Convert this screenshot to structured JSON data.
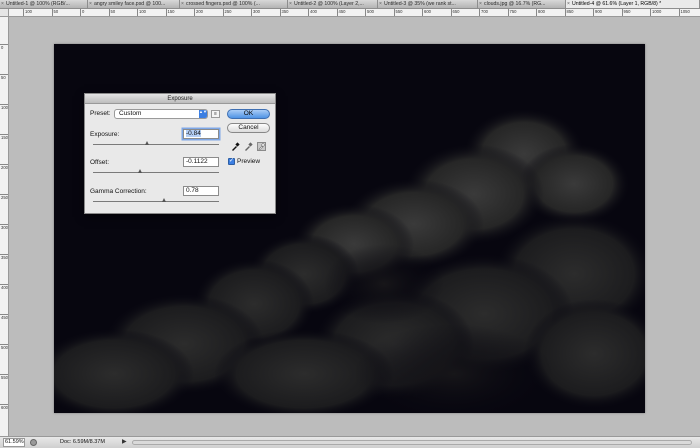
{
  "tabs": [
    {
      "label": "Untitled-1 @ 100% (RGB/..."
    },
    {
      "label": "angry smiley face.psd @ 100..."
    },
    {
      "label": "crossed fingers.psd @ 100% (..."
    },
    {
      "label": "Untitled-2 @ 100% (Layer 2,..."
    },
    {
      "label": "Untitled-3 @ 35% (we rank st..."
    },
    {
      "label": "clouds.jpg @ 16.7% (RG..."
    },
    {
      "label": "Untitled-4 @ 61.6% (Layer 1, RGB/8) *"
    }
  ],
  "rulers": {
    "horizontal": [
      "100",
      "50",
      "0",
      "50",
      "100",
      "150",
      "200",
      "250",
      "300",
      "350",
      "400",
      "450",
      "500",
      "550",
      "600",
      "650",
      "700",
      "750",
      "800",
      "850",
      "900",
      "950",
      "1000",
      "1050"
    ],
    "vertical": [
      "0",
      "50",
      "100",
      "150",
      "200",
      "250",
      "300",
      "350",
      "400",
      "450",
      "500",
      "550",
      "600"
    ]
  },
  "status": {
    "zoom": "61.59%",
    "doc": "Doc: 6.59M/8.37M",
    "arrow": "▶"
  },
  "dialog": {
    "title": "Exposure",
    "preset_label": "Preset:",
    "preset_value": "Custom",
    "preset_menu_icon": "≡",
    "exposure_label": "Exposure:",
    "exposure_value": "-0.84",
    "offset_label": "Offset:",
    "offset_value": "-0.1122",
    "gamma_label": "Gamma Correction:",
    "gamma_value": "0.78",
    "ok_label": "OK",
    "cancel_label": "Cancel",
    "preview_label": "Preview",
    "preview_checked": true,
    "close_x": "×",
    "check_mark": "✓",
    "stepper_glyph": "▲▼"
  },
  "colors": {
    "image_bg": "#07060f",
    "accent": "#3c7fe2"
  }
}
